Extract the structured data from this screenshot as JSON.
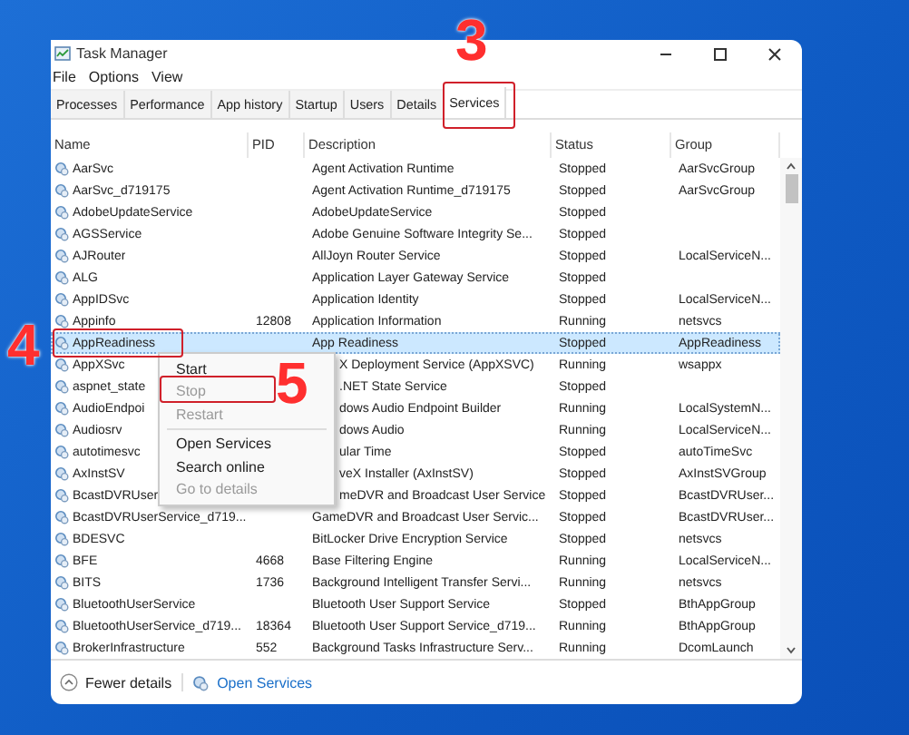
{
  "annotations": [
    {
      "text": "3",
      "kind": "tab"
    },
    {
      "text": "4",
      "kind": "row"
    },
    {
      "text": "5",
      "kind": "menu"
    }
  ],
  "window": {
    "title": "Task Manager"
  },
  "menu_bar": [
    "File",
    "Options",
    "View"
  ],
  "tabs": [
    {
      "label": "Processes",
      "selected": false
    },
    {
      "label": "Performance",
      "selected": false
    },
    {
      "label": "App history",
      "selected": false
    },
    {
      "label": "Startup",
      "selected": false
    },
    {
      "label": "Users",
      "selected": false
    },
    {
      "label": "Details",
      "selected": false
    },
    {
      "label": "Services",
      "selected": true
    }
  ],
  "table": {
    "columns": [
      "Name",
      "PID",
      "Description",
      "Status",
      "Group"
    ],
    "rows": [
      {
        "name": "AarSvc",
        "pid": "",
        "description": "Agent Activation Runtime",
        "status": "Stopped",
        "group": "AarSvcGroup",
        "selected": false,
        "under_menu": false
      },
      {
        "name": "AarSvc_d719175",
        "pid": "",
        "description": "Agent Activation Runtime_d719175",
        "status": "Stopped",
        "group": "AarSvcGroup",
        "selected": false,
        "under_menu": false
      },
      {
        "name": "AdobeUpdateService",
        "pid": "",
        "description": "AdobeUpdateService",
        "status": "Stopped",
        "group": "",
        "selected": false,
        "under_menu": false
      },
      {
        "name": "AGSService",
        "pid": "",
        "description": "Adobe Genuine Software Integrity Se...",
        "status": "Stopped",
        "group": "",
        "selected": false,
        "under_menu": false
      },
      {
        "name": "AJRouter",
        "pid": "",
        "description": "AllJoyn Router Service",
        "status": "Stopped",
        "group": "LocalServiceN...",
        "selected": false,
        "under_menu": false
      },
      {
        "name": "ALG",
        "pid": "",
        "description": "Application Layer Gateway Service",
        "status": "Stopped",
        "group": "",
        "selected": false,
        "under_menu": false
      },
      {
        "name": "AppIDSvc",
        "pid": "",
        "description": "Application Identity",
        "status": "Stopped",
        "group": "LocalServiceN...",
        "selected": false,
        "under_menu": false
      },
      {
        "name": "Appinfo",
        "pid": "12808",
        "description": "Application Information",
        "status": "Running",
        "group": "netsvcs",
        "selected": false,
        "under_menu": false
      },
      {
        "name": "AppReadiness",
        "pid": "",
        "description": "App Readiness",
        "status": "Stopped",
        "group": "AppReadiness",
        "selected": true,
        "under_menu": false
      },
      {
        "name": "AppXSvc",
        "pid": "",
        "description": "X Deployment Service (AppXSVC)",
        "status": "Running",
        "group": "wsappx",
        "selected": false,
        "under_menu": true
      },
      {
        "name": "aspnet_state",
        "pid": "",
        "description": ".NET State Service",
        "status": "Stopped",
        "group": "",
        "selected": false,
        "under_menu": true
      },
      {
        "name": "AudioEndpoi",
        "pid": "",
        "description": "dows Audio Endpoint Builder",
        "status": "Running",
        "group": "LocalSystemN...",
        "selected": false,
        "under_menu": true
      },
      {
        "name": "Audiosrv",
        "pid": "",
        "description": "dows Audio",
        "status": "Running",
        "group": "LocalServiceN...",
        "selected": false,
        "under_menu": true
      },
      {
        "name": "autotimesvc",
        "pid": "",
        "description": "ular Time",
        "status": "Stopped",
        "group": "autoTimeSvc",
        "selected": false,
        "under_menu": true
      },
      {
        "name": "AxInstSV",
        "pid": "",
        "description": "veX Installer (AxInstSV)",
        "status": "Stopped",
        "group": "AxInstSVGroup",
        "selected": false,
        "under_menu": true
      },
      {
        "name": "BcastDVRUser",
        "pid": "",
        "description": "meDVR and Broadcast User Service",
        "status": "Stopped",
        "group": "BcastDVRUser...",
        "selected": false,
        "under_menu": true
      },
      {
        "name": "BcastDVRUserService_d719...",
        "pid": "",
        "description": "GameDVR and Broadcast User Servic...",
        "status": "Stopped",
        "group": "BcastDVRUser...",
        "selected": false,
        "under_menu": false
      },
      {
        "name": "BDESVC",
        "pid": "",
        "description": "BitLocker Drive Encryption Service",
        "status": "Stopped",
        "group": "netsvcs",
        "selected": false,
        "under_menu": false
      },
      {
        "name": "BFE",
        "pid": "4668",
        "description": "Base Filtering Engine",
        "status": "Running",
        "group": "LocalServiceN...",
        "selected": false,
        "under_menu": false
      },
      {
        "name": "BITS",
        "pid": "1736",
        "description": "Background Intelligent Transfer Servi...",
        "status": "Running",
        "group": "netsvcs",
        "selected": false,
        "under_menu": false
      },
      {
        "name": "BluetoothUserService",
        "pid": "",
        "description": "Bluetooth User Support Service",
        "status": "Stopped",
        "group": "BthAppGroup",
        "selected": false,
        "under_menu": false
      },
      {
        "name": "BluetoothUserService_d719...",
        "pid": "18364",
        "description": "Bluetooth User Support Service_d719...",
        "status": "Running",
        "group": "BthAppGroup",
        "selected": false,
        "under_menu": false
      },
      {
        "name": "BrokerInfrastructure",
        "pid": "552",
        "description": "Background Tasks Infrastructure Serv...",
        "status": "Running",
        "group": "DcomLaunch",
        "selected": false,
        "under_menu": false
      }
    ]
  },
  "context_menu": [
    {
      "label": "Start",
      "disabled": false,
      "kind": "item"
    },
    {
      "label": "Stop",
      "disabled": true,
      "kind": "item"
    },
    {
      "label": "Restart",
      "disabled": true,
      "kind": "item"
    },
    {
      "kind": "separator"
    },
    {
      "label": "Open Services",
      "disabled": false,
      "kind": "item"
    },
    {
      "label": "Search online",
      "disabled": false,
      "kind": "item"
    },
    {
      "label": "Go to details",
      "disabled": true,
      "kind": "item"
    }
  ],
  "footer": {
    "toggle": "Fewer details",
    "link": "Open Services"
  }
}
